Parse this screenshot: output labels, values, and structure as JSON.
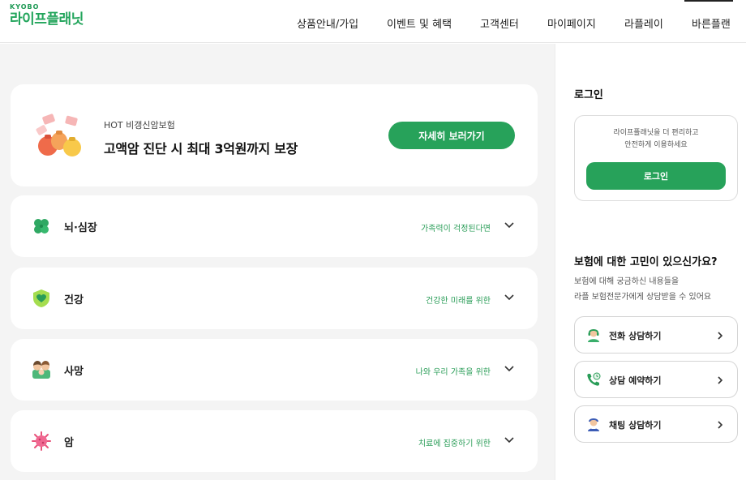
{
  "header": {
    "logo_sub": "KYOBO",
    "logo_main": "라이프플래닛",
    "nav": [
      {
        "label": "상품안내/가입"
      },
      {
        "label": "이벤트 및 혜택"
      },
      {
        "label": "고객센터"
      },
      {
        "label": "마이페이지"
      },
      {
        "label": "라플레이"
      },
      {
        "label": "바른플랜"
      }
    ]
  },
  "promo": {
    "tag": "HOT 비갱신암보험",
    "title": "고액암 진단 시 최대 3억원까지 보장",
    "button": "자세히 보러가기"
  },
  "categories": [
    {
      "label": "뇌·심장",
      "sub": "가족력이 걱정된다면",
      "icon": "clover-icon"
    },
    {
      "label": "건강",
      "sub": "건강한 미래를 위한",
      "icon": "shield-heart-icon"
    },
    {
      "label": "사망",
      "sub": "나와 우리 가족을 위한",
      "icon": "family-icon"
    },
    {
      "label": "암",
      "sub": "치료에 집중하기 위한",
      "icon": "virus-icon"
    }
  ],
  "sidebar": {
    "login_title": "로그인",
    "login_msg_line1": "라이프플래닛을 더 편리하고",
    "login_msg_line2": "안전하게 이용하세요",
    "login_button": "로그인",
    "consult_title": "보험에 대한 고민이 있으신가요?",
    "consult_desc_line1": "보험에 대해 궁금하신 내용들을",
    "consult_desc_line2": "라플 보험전문가에게 상담받을 수 있어요",
    "consult_buttons": [
      {
        "label": "전화 상담하기",
        "icon": "headset-agent-icon"
      },
      {
        "label": "상담 예약하기",
        "icon": "phone-clock-icon"
      },
      {
        "label": "채팅 상담하기",
        "icon": "chat-agent-icon"
      }
    ]
  },
  "colors": {
    "brand_green": "#27a25a",
    "background_gray": "#f4f4f4"
  }
}
